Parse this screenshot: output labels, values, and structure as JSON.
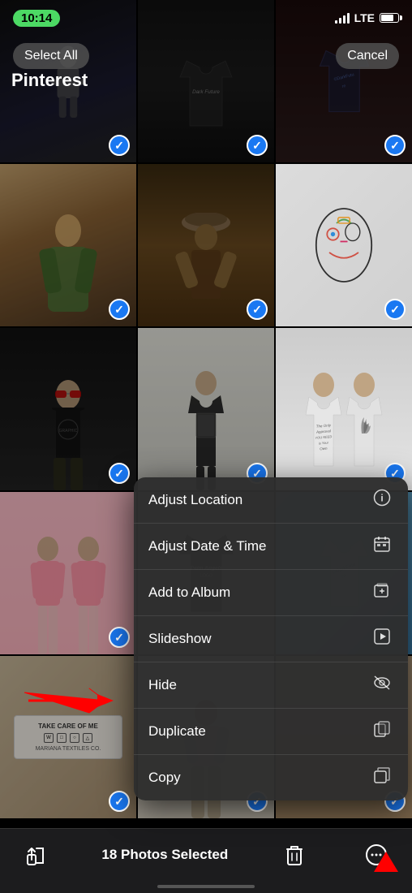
{
  "statusBar": {
    "time": "10:14",
    "signal": "LTE"
  },
  "header": {
    "selectAllLabel": "Select All",
    "cancelLabel": "Cancel",
    "albumTitle": "Pinterest"
  },
  "bottomToolbar": {
    "shareLabel": "share",
    "centerText": "18 Photos Selected",
    "deleteLabel": "delete",
    "moreLabel": "more"
  },
  "contextMenu": {
    "items": [
      {
        "id": "adjust-location",
        "label": "Adjust Location",
        "icon": "info-circle"
      },
      {
        "id": "adjust-date-time",
        "label": "Adjust Date & Time",
        "icon": "calendar"
      },
      {
        "id": "add-to-album",
        "label": "Add to Album",
        "icon": "album"
      },
      {
        "id": "slideshow",
        "label": "Slideshow",
        "icon": "play"
      },
      {
        "id": "hide",
        "label": "Hide",
        "icon": "eye-slash"
      },
      {
        "id": "duplicate",
        "label": "Duplicate",
        "icon": "duplicate"
      },
      {
        "id": "copy",
        "label": "Copy",
        "icon": "copy"
      }
    ]
  },
  "photos": [
    {
      "id": 1,
      "checked": true,
      "colorClass": "p1"
    },
    {
      "id": 2,
      "checked": true,
      "colorClass": "p2"
    },
    {
      "id": 3,
      "checked": true,
      "colorClass": "p3"
    },
    {
      "id": 4,
      "checked": true,
      "colorClass": "p4"
    },
    {
      "id": 5,
      "checked": true,
      "colorClass": "p5"
    },
    {
      "id": 6,
      "checked": true,
      "colorClass": "p6"
    },
    {
      "id": 7,
      "checked": true,
      "colorClass": "p7"
    },
    {
      "id": 8,
      "checked": true,
      "colorClass": "p8"
    },
    {
      "id": 9,
      "checked": true,
      "colorClass": "p9"
    },
    {
      "id": 10,
      "checked": true,
      "colorClass": "p10"
    },
    {
      "id": 11,
      "checked": false,
      "colorClass": "p11"
    },
    {
      "id": 12,
      "checked": false,
      "colorClass": "p12"
    },
    {
      "id": 13,
      "checked": true,
      "colorClass": "p13"
    },
    {
      "id": 14,
      "checked": true,
      "colorClass": "p14"
    },
    {
      "id": 15,
      "checked": true,
      "colorClass": "p15"
    }
  ]
}
